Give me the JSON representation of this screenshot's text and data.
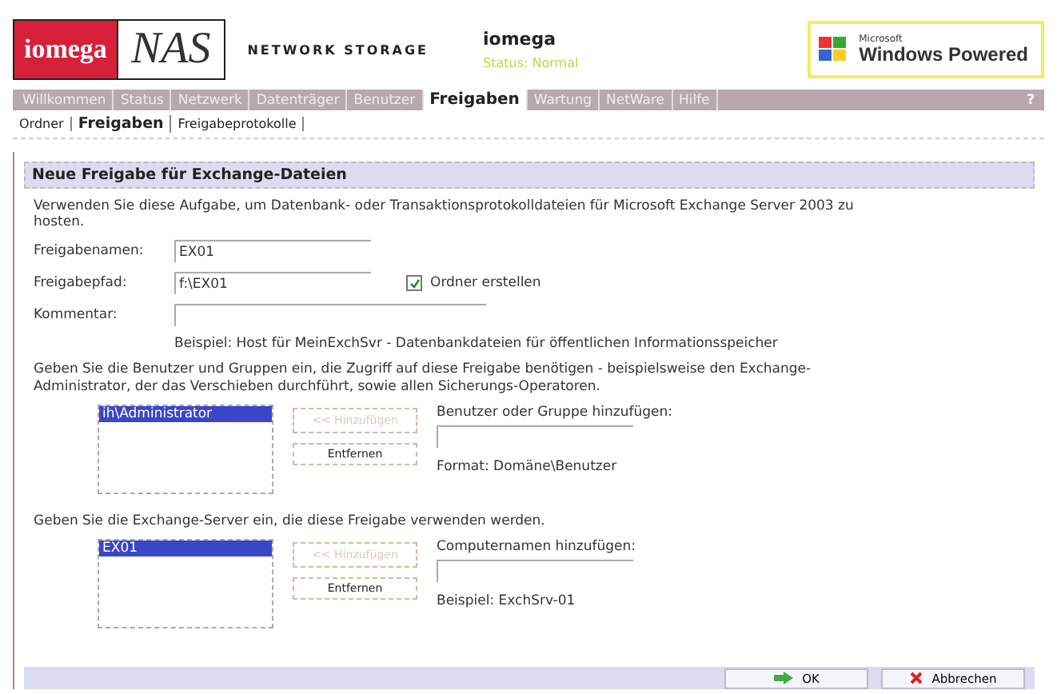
{
  "header": {
    "brand": "iomega",
    "product": "NAS",
    "tagline": "NETWORK STORAGE",
    "server_name": "iomega",
    "status": "Status: Normal",
    "badge": {
      "maker": "Microsoft",
      "text": "Windows Powered"
    }
  },
  "nav": {
    "items": [
      {
        "label": "Willkommen",
        "selected": false
      },
      {
        "label": "Status",
        "selected": false
      },
      {
        "label": "Netzwerk",
        "selected": false
      },
      {
        "label": "Datenträger",
        "selected": false
      },
      {
        "label": "Benutzer",
        "selected": false
      },
      {
        "label": "Freigaben",
        "selected": true
      },
      {
        "label": "Wartung",
        "selected": false
      },
      {
        "label": "NetWare",
        "selected": false
      },
      {
        "label": "Hilfe",
        "selected": false
      }
    ],
    "help": "?"
  },
  "subnav": [
    {
      "label": "Ordner",
      "selected": false
    },
    {
      "label": "Freigaben",
      "selected": true
    },
    {
      "label": "Freigabeprotokolle",
      "selected": false
    }
  ],
  "section_title": "Neue Freigabe für Exchange-Dateien",
  "intro": "Verwenden Sie diese Aufgabe, um Datenbank- oder Transaktionsprotokolldateien für Microsoft Exchange Server 2003 zu hosten.",
  "fields": [
    {
      "label": "Freigabenamen:",
      "value": "EX01"
    },
    {
      "label": "Freigabepfad:",
      "value": "f:\\EX01",
      "option": {
        "label": "Ordner erstellen",
        "checked": true
      }
    },
    {
      "label": "Kommentar:"
    }
  ],
  "comment_example": "Beispiel: Host für MeinExchSvr - Datenbankdateien für öffentlichen Informationsspeicher",
  "groups": [
    {
      "description": "Geben Sie die Benutzer und Gruppen ein, die Zugriff auf diese Freigabe benötigen - beispielsweise den Exchange-Administrator, der das Verschieben durchführt, sowie allen Sicherungs-Operatoren.",
      "items": [
        {
          "label": "ih\\Administrator",
          "selected": true
        }
      ],
      "add_button": {
        "label": "<< Hinzufügen",
        "disabled": true
      },
      "remove_button": "Entfernen",
      "input_label": "Benutzer oder Gruppe hinzufügen:",
      "hint": "Format: Domäne\\Benutzer"
    },
    {
      "description": "Geben Sie die Exchange-Server ein, die diese Freigabe verwenden werden.",
      "items": [
        {
          "label": "EX01",
          "selected": true
        }
      ],
      "add_button": {
        "label": "<< Hinzufügen",
        "disabled": true
      },
      "remove_button": "Entfernen",
      "input_label": "Computernamen hinzufügen:",
      "hint": "Beispiel: ExchSrv-01"
    }
  ],
  "footer": {
    "ok": "OK",
    "cancel": "Abbrechen"
  }
}
